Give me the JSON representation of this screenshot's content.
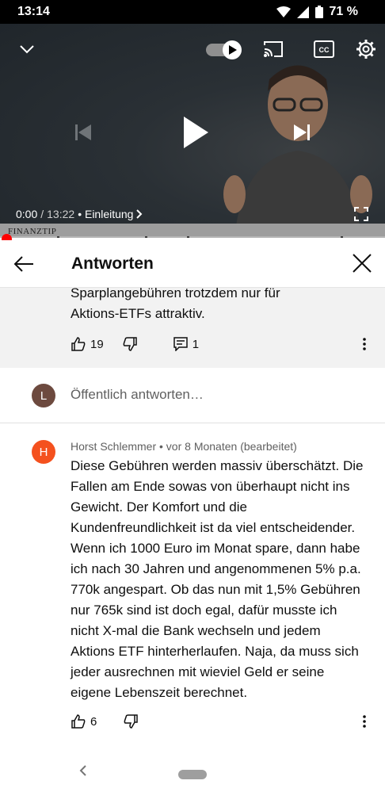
{
  "status_bar": {
    "time": "13:14",
    "battery": "71 %"
  },
  "video": {
    "current_time": "0:00",
    "separator": "/",
    "duration": "13:22",
    "chapter": "• Einleitung",
    "logo": "FINANZTIP",
    "progress": 0.0
  },
  "header": {
    "title": "Antworten"
  },
  "parent_comment": {
    "text_line1": "Sparplangebühren trotzdem nur für",
    "text_line2": "Aktions-ETFs attraktiv.",
    "likes": "19",
    "replies": "1"
  },
  "reply_input": {
    "avatar_letter": "L",
    "avatar_color": "#6d4a3f",
    "placeholder": "Öffentlich antworten…"
  },
  "comment": {
    "avatar_letter": "H",
    "avatar_color": "#f4511e",
    "meta": "Horst Schlemmer • vor 8 Monaten (bearbeitet)",
    "lines": [
      "Diese Gebühren werden massiv überschätzt. Die",
      "Fallen am Ende sowas von überhaupt nicht ins",
      "Gewicht. Der Komfort und die",
      "Kundenfreundlichkeit ist da viel entscheidender.",
      "Wenn ich 1000 Euro im Monat spare, dann habe",
      "ich nach 30 Jahren und angenommenen 5% p.a.",
      "770k angespart. Ob das nun mit 1,5% Gebühren",
      "nur 765k sind ist doch egal, dafür musste ich",
      "nicht X-mal die Bank wechseln und jedem",
      "Aktions ETF hinterherlaufen. Naja, da muss sich",
      "jeder ausrechnen mit wieviel Geld er seine",
      "eigene Lebenszeit berechnet."
    ],
    "likes": "6"
  }
}
